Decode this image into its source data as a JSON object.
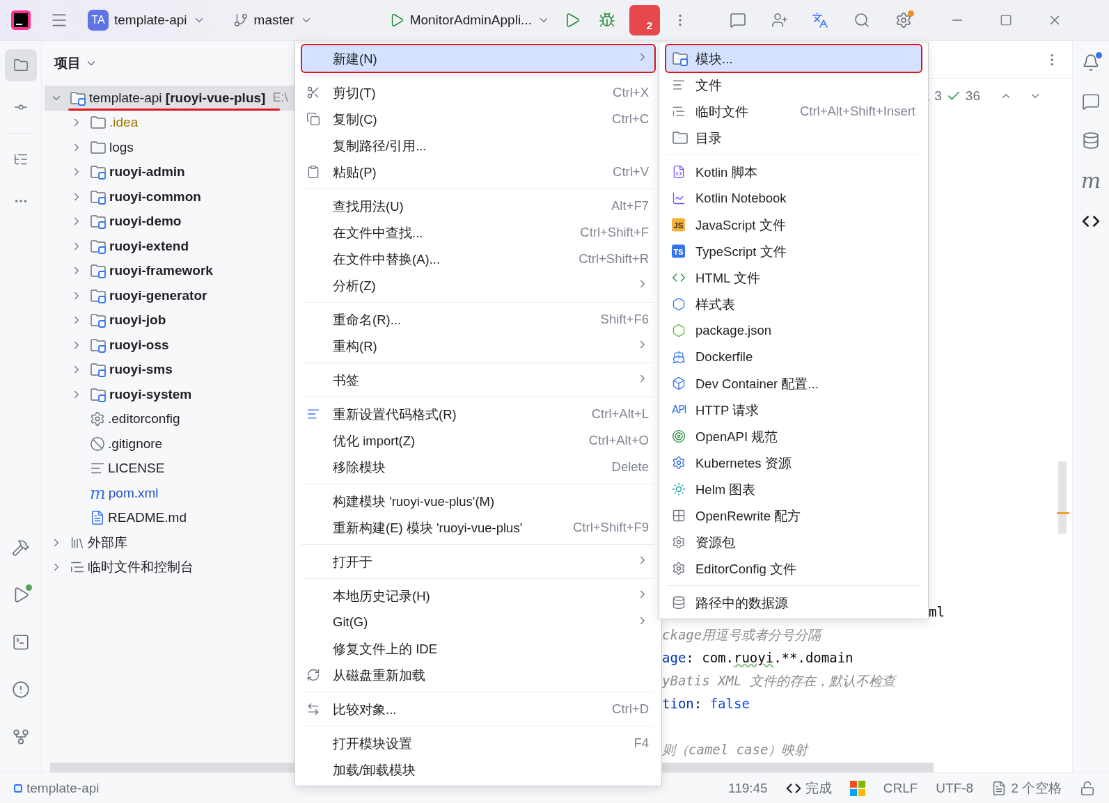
{
  "title_bar": {
    "project_badge": "TA",
    "project": "template-api",
    "branch": "master",
    "run_config": "MonitorAdminAppli...",
    "profiler_count": "2",
    "settings_update": true
  },
  "left_toolbar": [
    {
      "selected": true
    },
    {
      "selected": false
    },
    {
      "selected": false
    },
    {
      "selected": false
    }
  ],
  "project_panel": {
    "title": "项目",
    "tree": [
      {
        "name": "template-api **[ruoyi-vue-plus]**",
        "path": "E:\\",
        "kind": "module",
        "expanded": true,
        "selected": true,
        "annotated": true,
        "children": [
          {
            "name": ".idea",
            "kind": "excluded",
            "expanded": false
          },
          {
            "name": "logs",
            "kind": "folder",
            "expanded": false
          },
          {
            "name": "ruoyi-admin",
            "kind": "module",
            "expanded": false
          },
          {
            "name": "ruoyi-common",
            "kind": "module",
            "expanded": false
          },
          {
            "name": "ruoyi-demo",
            "kind": "module",
            "expanded": false
          },
          {
            "name": "ruoyi-extend",
            "kind": "module",
            "expanded": false
          },
          {
            "name": "ruoyi-framework",
            "kind": "module",
            "expanded": false
          },
          {
            "name": "ruoyi-generator",
            "kind": "module",
            "expanded": false
          },
          {
            "name": "ruoyi-job",
            "kind": "module",
            "expanded": false
          },
          {
            "name": "ruoyi-oss",
            "kind": "module",
            "expanded": false
          },
          {
            "name": "ruoyi-sms",
            "kind": "module",
            "expanded": false
          },
          {
            "name": "ruoyi-system",
            "kind": "module",
            "expanded": false
          },
          {
            "name": ".editorconfig",
            "kind": "settings"
          },
          {
            "name": ".gitignore",
            "kind": "ignore"
          },
          {
            "name": "LICENSE",
            "kind": "text"
          },
          {
            "name": "pom.xml",
            "kind": "maven",
            "icon_letter": "m"
          },
          {
            "name": "README.md",
            "kind": "markdown"
          }
        ]
      },
      {
        "name": "外部库",
        "kind": "library",
        "expanded": false
      },
      {
        "name": "临时文件和控制台",
        "kind": "scratch",
        "expanded": false
      }
    ]
  },
  "editor": {
    "inspections": {
      "warnings": "3",
      "passed": "36"
    },
    "code_lines": [
      {
        "segments": [
          {
            "text": "ml",
            "kind": "plain"
          }
        ]
      },
      {
        "segments": [
          {
            "text": "ckage用逗号或者分号分隔",
            "kind": "comment"
          }
        ]
      },
      {
        "segments": [
          {
            "text": "age",
            "kind": "key"
          },
          {
            "text": ": com.",
            "kind": "plain"
          },
          {
            "text": "ruoyi",
            "kind": "typo"
          },
          {
            "text": ".**.domain",
            "kind": "plain"
          }
        ]
      },
      {
        "segments": [
          {
            "text": "yBatis XML 文件的存在，默认不检查",
            "kind": "comment"
          }
        ]
      },
      {
        "segments": [
          {
            "text": "tion",
            "kind": "key"
          },
          {
            "text": ": ",
            "kind": "plain"
          },
          {
            "text": "false",
            "kind": "keyword"
          }
        ]
      },
      {
        "segments": [
          {
            "text": "则（camel case）映射",
            "kind": "comment"
          }
        ]
      }
    ]
  },
  "context_menu": {
    "items": [
      {
        "kind": "item",
        "label": "新建(N)",
        "submenu": true,
        "selected": true,
        "annotated": true
      },
      {
        "kind": "separator"
      },
      {
        "kind": "cut",
        "label": "剪切(T)",
        "shortcut": "Ctrl+X"
      },
      {
        "kind": "copy",
        "label": "复制(C)",
        "shortcut": "Ctrl+C"
      },
      {
        "kind": "item",
        "label": "复制路径/引用..."
      },
      {
        "kind": "paste",
        "label": "粘贴(P)",
        "shortcut": "Ctrl+V"
      },
      {
        "kind": "separator"
      },
      {
        "kind": "item",
        "label": "查找用法(U)",
        "shortcut": "Alt+F7"
      },
      {
        "kind": "item",
        "label": "在文件中查找...",
        "shortcut": "Ctrl+Shift+F"
      },
      {
        "kind": "item",
        "label": "在文件中替换(A)...",
        "shortcut": "Ctrl+Shift+R"
      },
      {
        "kind": "item",
        "label": "分析(Z)",
        "submenu": true
      },
      {
        "kind": "separator"
      },
      {
        "kind": "item",
        "label": "重命名(R)...",
        "shortcut": "Shift+F6"
      },
      {
        "kind": "item",
        "label": "重构(R)",
        "submenu": true
      },
      {
        "kind": "separator"
      },
      {
        "kind": "item",
        "label": "书签",
        "submenu": true
      },
      {
        "kind": "separator"
      },
      {
        "kind": "format",
        "label": "重新设置代码格式(R)",
        "shortcut": "Ctrl+Alt+L"
      },
      {
        "kind": "item",
        "label": "优化 import(Z)",
        "shortcut": "Ctrl+Alt+O"
      },
      {
        "kind": "item",
        "label": "移除模块",
        "shortcut": "Delete"
      },
      {
        "kind": "separator"
      },
      {
        "kind": "item",
        "label": "构建模块 'ruoyi-vue-plus'(M)"
      },
      {
        "kind": "item",
        "label": "重新构建(E) 模块 'ruoyi-vue-plus'",
        "shortcut": "Ctrl+Shift+F9"
      },
      {
        "kind": "separator"
      },
      {
        "kind": "item",
        "label": "打开于",
        "submenu": true
      },
      {
        "kind": "separator"
      },
      {
        "kind": "item",
        "label": "本地历史记录(H)",
        "submenu": true
      },
      {
        "kind": "item",
        "label": "Git(G)",
        "submenu": true
      },
      {
        "kind": "item",
        "label": "修复文件上的 IDE"
      },
      {
        "kind": "reload",
        "label": "从磁盘重新加载"
      },
      {
        "kind": "separator"
      },
      {
        "kind": "compare",
        "label": "比较对象...",
        "shortcut": "Ctrl+D"
      },
      {
        "kind": "separator"
      },
      {
        "kind": "item",
        "label": "打开模块设置",
        "shortcut": "F4"
      },
      {
        "kind": "item",
        "label": "加载/卸载模块"
      }
    ]
  },
  "new_submenu": {
    "items": [
      {
        "kind": "module",
        "label": "模块...",
        "selected": true,
        "annotated": true
      },
      {
        "kind": "file",
        "label": "文件"
      },
      {
        "kind": "scratch",
        "label": "临时文件",
        "shortcut": "Ctrl+Alt+Shift+Insert"
      },
      {
        "kind": "directory",
        "label": "目录"
      },
      {
        "kind": "separator"
      },
      {
        "kind": "kotlin-script",
        "label": "Kotlin 脚本"
      },
      {
        "kind": "kotlin-notebook",
        "label": "Kotlin Notebook"
      },
      {
        "kind": "badge",
        "badge": "JS",
        "color": "#f4af3d",
        "label": "JavaScript 文件"
      },
      {
        "kind": "badge",
        "badge": "TS",
        "color": "#3574f0",
        "label": "TypeScript 文件"
      },
      {
        "kind": "html",
        "label": "HTML 文件"
      },
      {
        "kind": "stylesheet",
        "label": "样式表"
      },
      {
        "kind": "package-json",
        "label": "package.json"
      },
      {
        "kind": "docker",
        "label": "Dockerfile"
      },
      {
        "kind": "dev-container",
        "label": "Dev Container 配置..."
      },
      {
        "kind": "api",
        "badge": "API",
        "label": "HTTP 请求"
      },
      {
        "kind": "openapi",
        "label": "OpenAPI 规范"
      },
      {
        "kind": "kubernetes",
        "label": "Kubernetes 资源"
      },
      {
        "kind": "helm",
        "label": "Helm 图表"
      },
      {
        "kind": "openrewrite",
        "label": "OpenRewrite 配方"
      },
      {
        "kind": "resource-bundle",
        "label": "资源包"
      },
      {
        "kind": "editorconfig",
        "label": "EditorConfig 文件"
      },
      {
        "kind": "separator"
      },
      {
        "kind": "datasource",
        "label": "路径中的数据源"
      }
    ]
  },
  "right_toolbar": {
    "maven_letter": "m"
  },
  "status_bar": {
    "project": "template-api",
    "position": "119:45",
    "ai_status": "完成",
    "line_separator": "CRLF",
    "encoding": "UTF-8",
    "indent": "2 个空格"
  }
}
